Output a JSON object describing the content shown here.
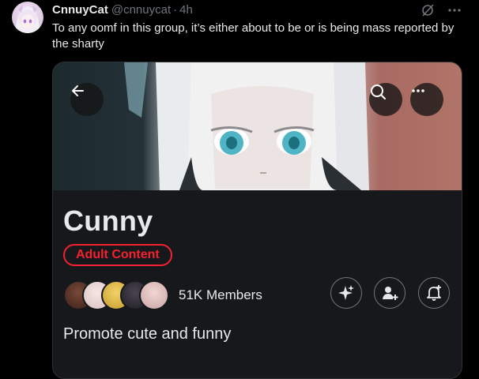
{
  "tweet": {
    "author_name": "CnnuyCat",
    "author_handle": "@cnnuycat",
    "separator": "·",
    "time": "4h",
    "text": "To any oomf in this group, it’s either about to be or is being mass reported by the sharty"
  },
  "community_card": {
    "name": "Cunny",
    "badge": "Adult Content",
    "members_label": "51K Members",
    "description": "Promote cute and funny"
  },
  "colors": {
    "background": "#000000",
    "card_background": "#16181c",
    "text_primary": "#e7e9ea",
    "text_secondary": "#71767b",
    "adult_badge": "#f4212e"
  },
  "icons": [
    "grok-icon",
    "more-icon",
    "back-arrow-icon",
    "search-icon",
    "more-icon",
    "sparkle-icon",
    "add-member-icon",
    "notification-bell-icon"
  ]
}
